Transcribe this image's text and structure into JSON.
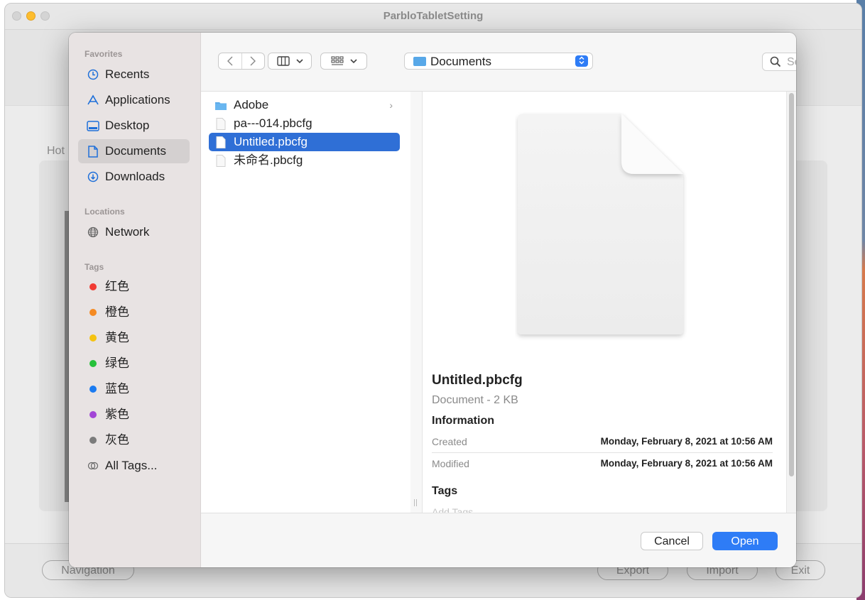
{
  "window": {
    "title": "ParbloTabletSetting",
    "hot_label": "Hot",
    "buttons": {
      "navigation": "Navigation",
      "export": "Export",
      "import": "Import",
      "exit": "Exit"
    }
  },
  "sidebar": {
    "favorites_title": "Favorites",
    "favorites": [
      {
        "label": "Recents",
        "icon": "clock-icon"
      },
      {
        "label": "Applications",
        "icon": "applications-icon"
      },
      {
        "label": "Desktop",
        "icon": "desktop-icon"
      },
      {
        "label": "Documents",
        "icon": "document-icon",
        "selected": true
      },
      {
        "label": "Downloads",
        "icon": "download-icon"
      }
    ],
    "locations_title": "Locations",
    "locations": [
      {
        "label": "Network",
        "icon": "globe-icon"
      }
    ],
    "tags_title": "Tags",
    "tags": [
      {
        "label": "红色",
        "color": "#f13b33"
      },
      {
        "label": "橙色",
        "color": "#f58a22"
      },
      {
        "label": "黄色",
        "color": "#f5c311"
      },
      {
        "label": "绿色",
        "color": "#26c13a"
      },
      {
        "label": "蓝色",
        "color": "#1b7bf1"
      },
      {
        "label": "紫色",
        "color": "#a246d6"
      },
      {
        "label": "灰色",
        "color": "#7b7b7b"
      }
    ],
    "all_tags": "All Tags..."
  },
  "toolbar": {
    "path": "Documents",
    "search_placeholder": "Search"
  },
  "files": [
    {
      "name": "Adobe",
      "type": "folder"
    },
    {
      "name": "pa---014.pbcfg",
      "type": "file"
    },
    {
      "name": "Untitled.pbcfg",
      "type": "file",
      "selected": true
    },
    {
      "name": "未命名.pbcfg",
      "type": "file"
    }
  ],
  "preview": {
    "name": "Untitled.pbcfg",
    "kind": "Document - 2 KB",
    "info_title": "Information",
    "created_label": "Created",
    "created_value": "Monday, February 8, 2021 at 10:56 AM",
    "modified_label": "Modified",
    "modified_value": "Monday, February 8, 2021 at 10:56 AM",
    "tags_title": "Tags",
    "add_tags_placeholder": "Add Tags..."
  },
  "footer": {
    "cancel": "Cancel",
    "open": "Open"
  },
  "colors": {
    "accent": "#2e7cf6",
    "selection": "#2f6fd6",
    "folder": "#58a8e8"
  }
}
